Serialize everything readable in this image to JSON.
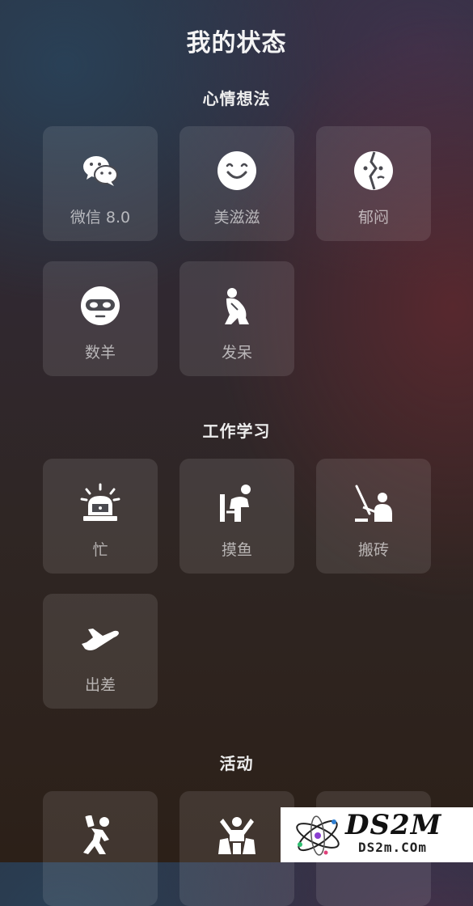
{
  "page": {
    "title": "我的状态"
  },
  "sections": [
    {
      "title": "心情想法",
      "items": [
        {
          "label": "微信 8.0",
          "icon": "wechat-icon"
        },
        {
          "label": "美滋滋",
          "icon": "smile-icon"
        },
        {
          "label": "郁闷",
          "icon": "gloomy-face-icon"
        },
        {
          "label": "数羊",
          "icon": "sleep-mask-face-icon"
        },
        {
          "label": "发呆",
          "icon": "dazed-person-icon"
        }
      ]
    },
    {
      "title": "工作学习",
      "items": [
        {
          "label": "忙",
          "icon": "alarm-light-icon"
        },
        {
          "label": "摸鱼",
          "icon": "slacking-person-icon"
        },
        {
          "label": "搬砖",
          "icon": "working-person-icon"
        },
        {
          "label": "出差",
          "icon": "airplane-icon"
        }
      ]
    },
    {
      "title": "活动",
      "items": [
        {
          "label": "",
          "icon": "running-person-icon"
        },
        {
          "label": "",
          "icon": "cheering-people-icon"
        },
        {
          "label": "",
          "icon": "unknown-icon"
        }
      ]
    }
  ],
  "watermark": {
    "brand": "DS2M",
    "domain": "DS2m.COm"
  }
}
